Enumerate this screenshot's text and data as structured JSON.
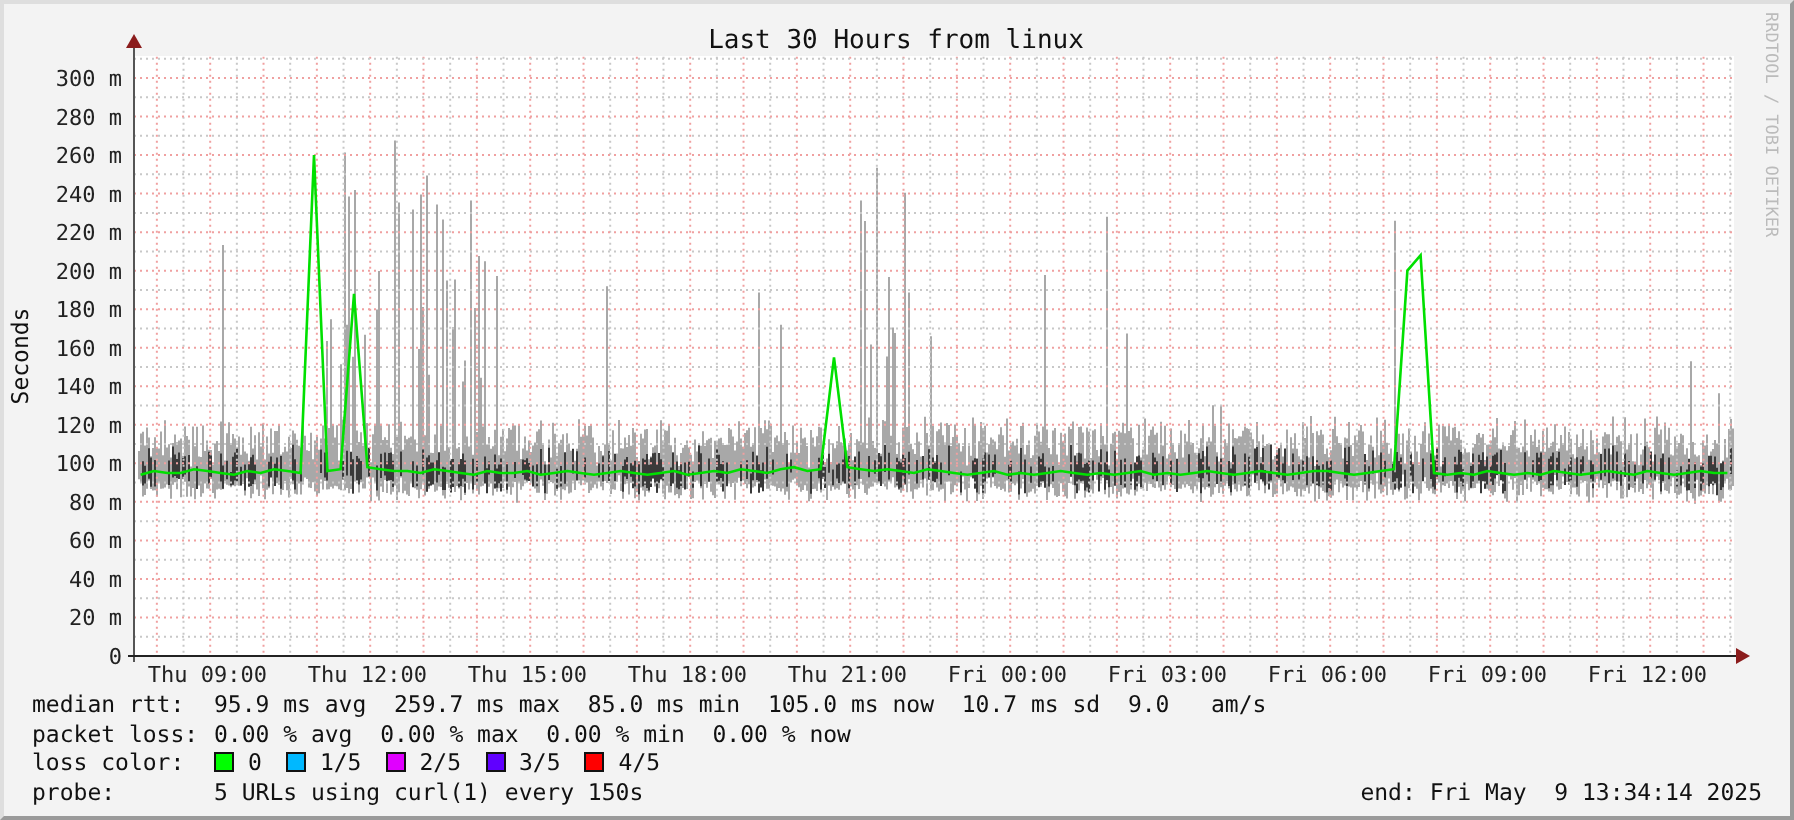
{
  "chart_data": {
    "type": "line",
    "title": "Last 30 Hours from linux",
    "ylabel": "Seconds",
    "ylim": [
      0,
      311
    ],
    "grid": true,
    "yticks": [
      {
        "value": 0,
        "label": "0"
      },
      {
        "value": 20,
        "label": "20 m"
      },
      {
        "value": 40,
        "label": "40 m"
      },
      {
        "value": 60,
        "label": "60 m"
      },
      {
        "value": 80,
        "label": "80 m"
      },
      {
        "value": 100,
        "label": "100 m"
      },
      {
        "value": 120,
        "label": "120 m"
      },
      {
        "value": 140,
        "label": "140 m"
      },
      {
        "value": 160,
        "label": "160 m"
      },
      {
        "value": 180,
        "label": "180 m"
      },
      {
        "value": 200,
        "label": "200 m"
      },
      {
        "value": 220,
        "label": "220 m"
      },
      {
        "value": 240,
        "label": "240 m"
      },
      {
        "value": 260,
        "label": "260 m"
      },
      {
        "value": 280,
        "label": "280 m"
      },
      {
        "value": 300,
        "label": "300 m"
      }
    ],
    "categories": [
      null,
      null,
      null,
      null,
      null,
      "Thu 09:00",
      null,
      null,
      null,
      null,
      null,
      null,
      null,
      null,
      null,
      null,
      null,
      "Thu 12:00",
      null,
      null,
      null,
      null,
      null,
      null,
      null,
      null,
      null,
      null,
      null,
      "Thu 15:00",
      null,
      null,
      null,
      null,
      null,
      null,
      null,
      null,
      null,
      null,
      null,
      "Thu 18:00",
      null,
      null,
      null,
      null,
      null,
      null,
      null,
      null,
      null,
      null,
      null,
      "Thu 21:00",
      null,
      null,
      null,
      null,
      null,
      null,
      null,
      null,
      null,
      null,
      null,
      "Fri 00:00",
      null,
      null,
      null,
      null,
      null,
      null,
      null,
      null,
      null,
      null,
      null,
      "Fri 03:00",
      null,
      null,
      null,
      null,
      null,
      null,
      null,
      null,
      null,
      null,
      null,
      "Fri 06:00",
      null,
      null,
      null,
      null,
      null,
      null,
      null,
      null,
      null,
      null,
      null,
      "Fri 09:00",
      null,
      null,
      null,
      null,
      null,
      null,
      null,
      null,
      null,
      null,
      null,
      "Fri 12:00",
      null,
      null,
      null,
      null,
      null,
      null
    ],
    "series": [
      {
        "name": "median rtt:",
        "color": "#00e000",
        "values": [
          94,
          96,
          95,
          95,
          97,
          96,
          95,
          94,
          96,
          95,
          97,
          96,
          95,
          260,
          96,
          97,
          188,
          98,
          97,
          96,
          96,
          95,
          97,
          96,
          95,
          94,
          96,
          95,
          95,
          96,
          94,
          95,
          96,
          95,
          94,
          95,
          96,
          95,
          94,
          95,
          96,
          94,
          95,
          96,
          95,
          97,
          96,
          95,
          97,
          98,
          96,
          97,
          155,
          98,
          97,
          96,
          97,
          96,
          95,
          97,
          96,
          95,
          94,
          95,
          96,
          94,
          95,
          94,
          95,
          96,
          95,
          94,
          95,
          94,
          95,
          96,
          94,
          95,
          94,
          95,
          96,
          95,
          94,
          95,
          96,
          95,
          94,
          95,
          96,
          96,
          95,
          94,
          95,
          96,
          97,
          200,
          208,
          95,
          94,
          95,
          94,
          96,
          95,
          94,
          95,
          94,
          96,
          95,
          94,
          95,
          96,
          95,
          94,
          96,
          95,
          94,
          95,
          96,
          95,
          95
        ]
      }
    ]
  },
  "side_text": "RRDTOOL / TOBI OETIKER",
  "legend": {
    "median_rtt": {
      "text": "95.9 ms avg  259.7 ms max  85.0 ms min  105.0 ms now  10.7 ms sd  9.0   am/s"
    },
    "packet_loss": {
      "label": "packet loss:",
      "text": "0.00 % avg  0.00 % max  0.00 % min  0.00 % now"
    },
    "loss_color": {
      "label": "loss color:",
      "items": [
        {
          "label": "0",
          "color": "#00ff00"
        },
        {
          "label": "1/5",
          "color": "#00b8ff"
        },
        {
          "label": "2/5",
          "color": "#e000ff"
        },
        {
          "label": "3/5",
          "color": "#6000ff"
        },
        {
          "label": "4/5",
          "color": "#ff0000"
        }
      ]
    },
    "probe": {
      "label": "probe:",
      "text": "5 URLs using curl(1) every 150s"
    },
    "end": "end: Fri May  9 13:34:14 2025"
  }
}
